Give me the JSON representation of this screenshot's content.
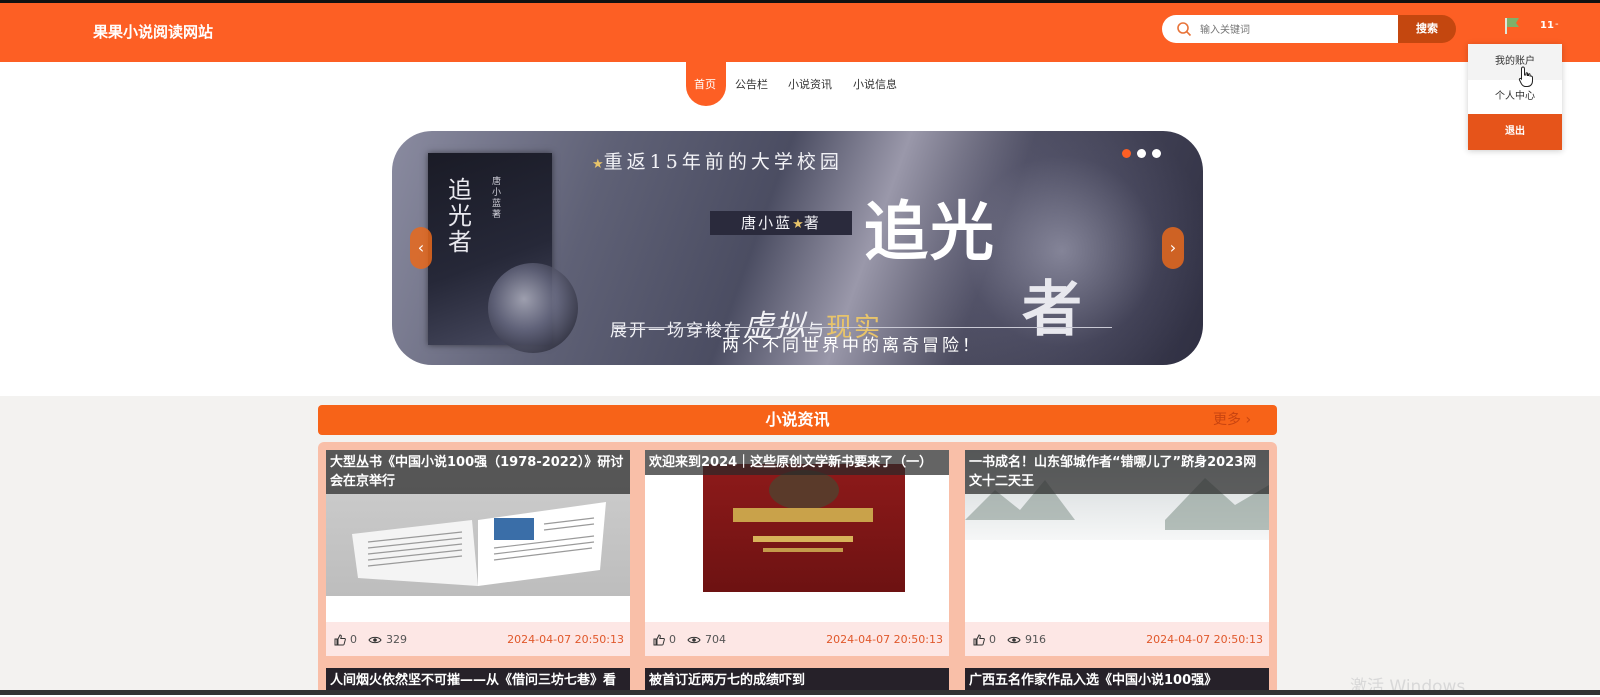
{
  "header": {
    "site_title": "果果小说阅读网站",
    "search_placeholder": "输入关键词",
    "search_button": "搜索",
    "user_label": "11",
    "caret": "-"
  },
  "dropdown": {
    "items": [
      "我的账户",
      "个人中心",
      "退出"
    ]
  },
  "nav": {
    "items": [
      "首页",
      "公告栏",
      "小说资讯",
      "小说信息"
    ]
  },
  "banner": {
    "headline": "重返15年前的大学校园",
    "author": "唐小蓝",
    "author_suffix": "著",
    "big_title_1": "追",
    "big_title_2": "光",
    "big_title_3": "者",
    "line1_a": "展开一场穿梭在",
    "line1_b": "虚拟",
    "line1_c": "与",
    "line1_d": "现实",
    "line2": "两个不同世界中的离奇冒险！",
    "cover_title": "追光者",
    "cover_author": "唐小蓝著",
    "prev_arrow": "‹",
    "next_arrow": "›",
    "slide_count": 3,
    "active_slide": 1
  },
  "section": {
    "title": "小说资讯",
    "more": "更多 ›"
  },
  "news": [
    {
      "title": "大型丛书《中国小说100强（1978-2022）》研讨会在京举行",
      "likes": "0",
      "views": "329",
      "date": "2024-04-07 20:50:13"
    },
    {
      "title": "欢迎来到2024｜这些原创文学新书要来了（一）",
      "likes": "0",
      "views": "704",
      "date": "2024-04-07 20:50:13"
    },
    {
      "title": "一书成名！山东邹城作者“错哪儿了”跻身2023网文十二天王",
      "likes": "0",
      "views": "916",
      "date": "2024-04-07 20:50:13"
    }
  ],
  "news_row2": [
    {
      "title": "人间烟火依然坚不可摧——从《借问三坊七巷》看"
    },
    {
      "title": "被首订近两万七的成绩吓到"
    },
    {
      "title": "广西五名作家作品入选《中国小说100强》"
    }
  ],
  "watermark": "激活 Windows",
  "colors": {
    "brand": "#fd5f24",
    "accent_dark": "#c4470f",
    "date": "#e0582b"
  }
}
